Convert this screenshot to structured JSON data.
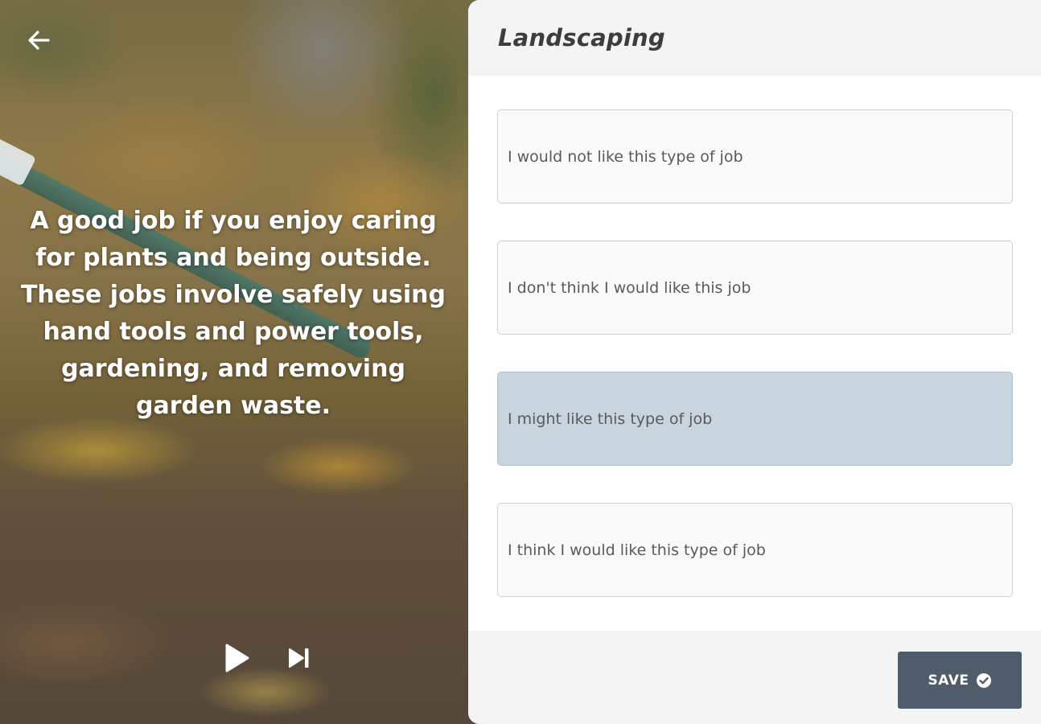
{
  "media": {
    "caption": "A good job if you enjoy caring for plants and being outside. These jobs involve safely using hand tools and power tools, gardening, and removing garden waste.",
    "back_icon": "arrow-left-icon",
    "play_icon": "play-icon",
    "skip_icon": "skip-next-icon"
  },
  "card": {
    "title": "Landscaping",
    "options": [
      {
        "label": "I would not like this type of job",
        "selected": false
      },
      {
        "label": "I don't think I would like this job",
        "selected": false
      },
      {
        "label": "I might like this type of job",
        "selected": true
      },
      {
        "label": "I think I would like this type of job",
        "selected": false
      }
    ],
    "save_label": "SAVE",
    "save_icon": "check-circle-icon"
  },
  "colors": {
    "selected_option_bg": "#c8d4de",
    "save_button_bg": "#4f5d6b",
    "header_bg": "#f4f4f4"
  }
}
